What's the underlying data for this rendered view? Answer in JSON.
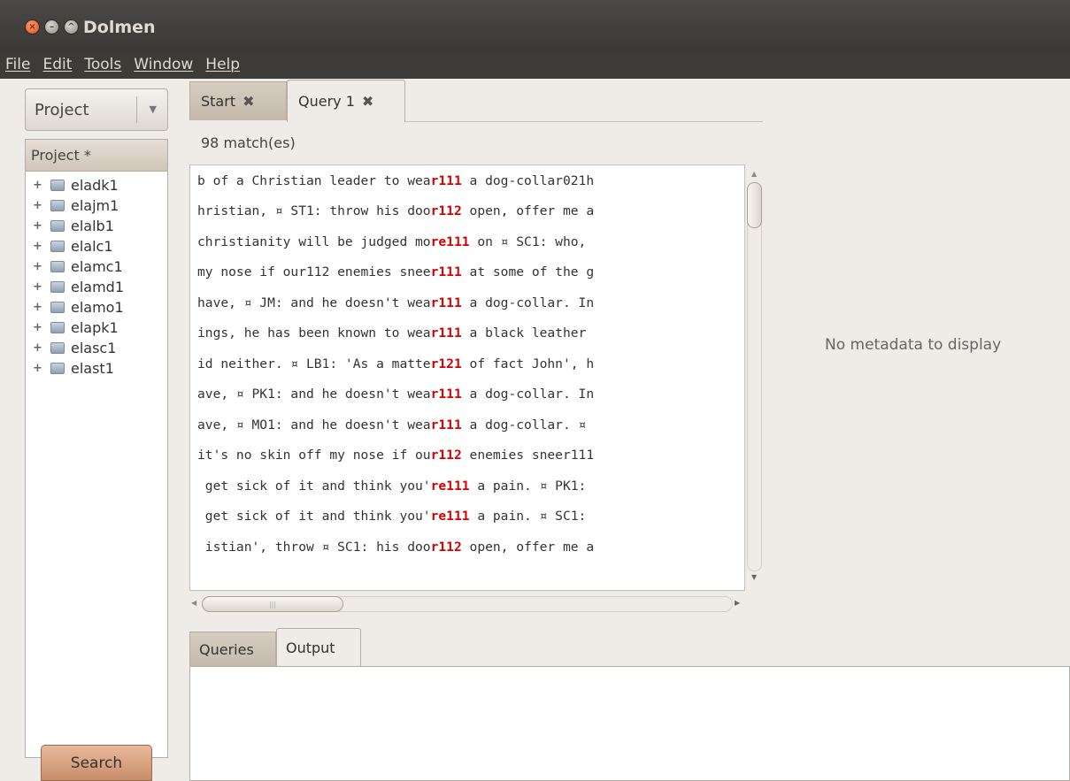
{
  "window": {
    "title": "Dolmen",
    "controls": [
      "×",
      "–",
      "^"
    ]
  },
  "menu": [
    "File",
    "Edit",
    "Tools",
    "Window",
    "Help"
  ],
  "sidebar": {
    "combo_label": "Project",
    "tree_header": "Project *",
    "items": [
      "eladk1",
      "elajm1",
      "elalb1",
      "elalc1",
      "elamc1",
      "elamd1",
      "elamo1",
      "elapk1",
      "elasc1",
      "elast1"
    ],
    "search_label": "Search"
  },
  "tabs": [
    {
      "label": "Start",
      "active": false
    },
    {
      "label": "Query 1",
      "active": true
    }
  ],
  "match_count": "98 match(es)",
  "results": [
    [
      "b of a Christian leader to wea",
      "r111",
      " a dog-collar021h"
    ],
    [
      "hristian, ¤ ST1: throw his doo",
      "r112",
      " open, offer me a"
    ],
    [
      "christianity will be judged mo",
      "re111",
      " on ¤ SC1: who,"
    ],
    [
      "my nose if our112 enemies snee",
      "r111",
      " at some of the g"
    ],
    [
      "have, ¤ JM: and he doesn't wea",
      "r111",
      " a dog-collar. In"
    ],
    [
      "ings, he has been known to wea",
      "r111",
      " a black leather"
    ],
    [
      "id neither. ¤ LB1: 'As a matte",
      "r121",
      " of fact John', h"
    ],
    [
      "ave, ¤ PK1: and he doesn't wea",
      "r111",
      " a dog-collar. In"
    ],
    [
      "ave, ¤ MO1: and he doesn't wea",
      "r111",
      " a dog-collar. ¤"
    ],
    [
      "it's no skin off my nose if ou",
      "r112",
      " enemies sneer111"
    ],
    [
      " get sick of it and think you'",
      "re111",
      " a pain. ¤ PK1:"
    ],
    [
      " get sick of it and think you'",
      "re111",
      " a pain. ¤ SC1:"
    ],
    [
      " istian', throw ¤ SC1: his doo",
      "r112",
      " open, offer me a"
    ]
  ],
  "metadata_text": "No metadata to display",
  "bottom_tabs": [
    {
      "label": "Queries",
      "active": false
    },
    {
      "label": "Output",
      "active": true
    }
  ],
  "colors": {
    "highlight": "#d40000",
    "titlebar": "#3c3b37",
    "search_button": "#c98e6a"
  }
}
